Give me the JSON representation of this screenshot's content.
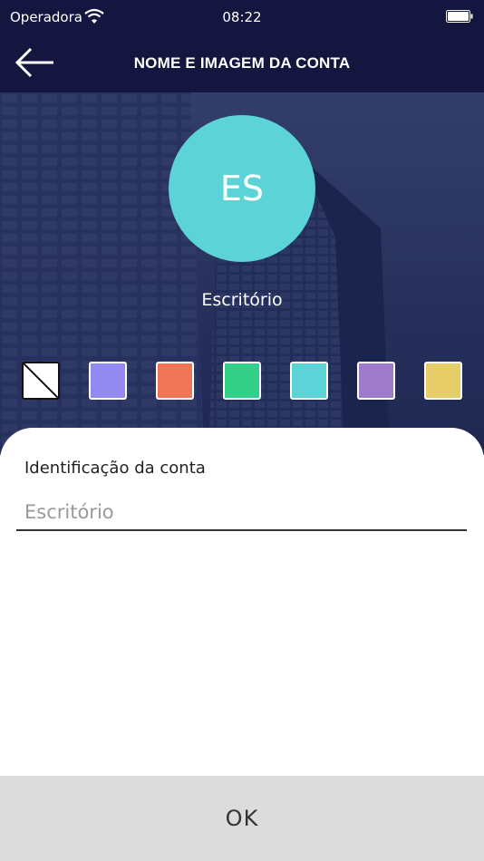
{
  "status_bar": {
    "carrier": "Operadora",
    "time": "08:22"
  },
  "header": {
    "title": "NOME E IMAGEM DA CONTA"
  },
  "avatar": {
    "initials": "ES",
    "color": "#5bd3d7"
  },
  "account_name": "Escritório",
  "swatches": [
    {
      "name": "none",
      "color": "#ffffff"
    },
    {
      "name": "purple-blue",
      "color": "#928af0"
    },
    {
      "name": "orange",
      "color": "#ef7556"
    },
    {
      "name": "green",
      "color": "#34d08a"
    },
    {
      "name": "cyan",
      "color": "#5bd3d7"
    },
    {
      "name": "lavender",
      "color": "#a07acb"
    },
    {
      "name": "yellow",
      "color": "#e6cd67"
    }
  ],
  "form": {
    "label": "Identificação da conta",
    "value": "",
    "placeholder": "Escritório"
  },
  "ok_button": {
    "label": "OK"
  },
  "colors": {
    "navbar": "#14163f",
    "footer": "#dcdcdc"
  }
}
